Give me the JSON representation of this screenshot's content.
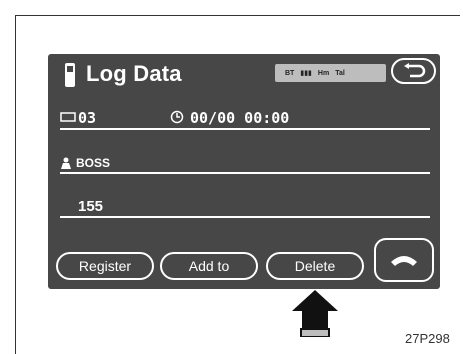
{
  "header": {
    "title": "Log Data",
    "status_items": [
      "BT",
      "Hm",
      "Tal"
    ]
  },
  "log": {
    "count": "03",
    "datetime": "00/00 00:00",
    "name": "BOSS",
    "number": "155"
  },
  "buttons": {
    "register": "Register",
    "add_to": "Add to",
    "delete": "Delete"
  },
  "figure_code": "27P298"
}
